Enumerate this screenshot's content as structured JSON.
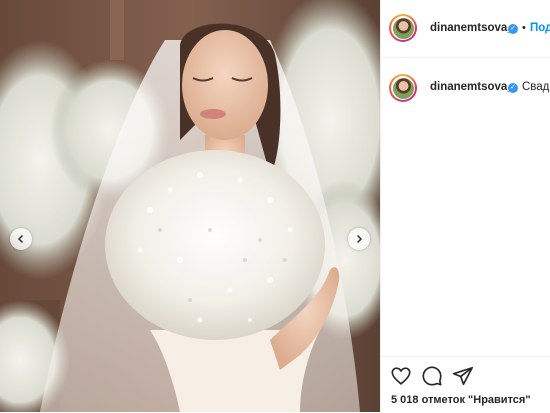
{
  "post": {
    "username": "dinanemtsova_",
    "follow_label": "Подп",
    "dot": "•",
    "caption_snippet": "Свадьб",
    "verified_glyph": "✓",
    "likes_text": "5 018 отметок \"Нравится\""
  },
  "icons": {
    "nav_prev": "chevron-left-icon",
    "nav_next": "chevron-right-icon",
    "like": "heart-icon",
    "comment": "comment-icon",
    "share": "paper-plane-icon"
  },
  "colors": {
    "link_blue": "#0095f6",
    "verified_blue": "#3897f0",
    "text": "#262626",
    "border": "#efefef"
  }
}
